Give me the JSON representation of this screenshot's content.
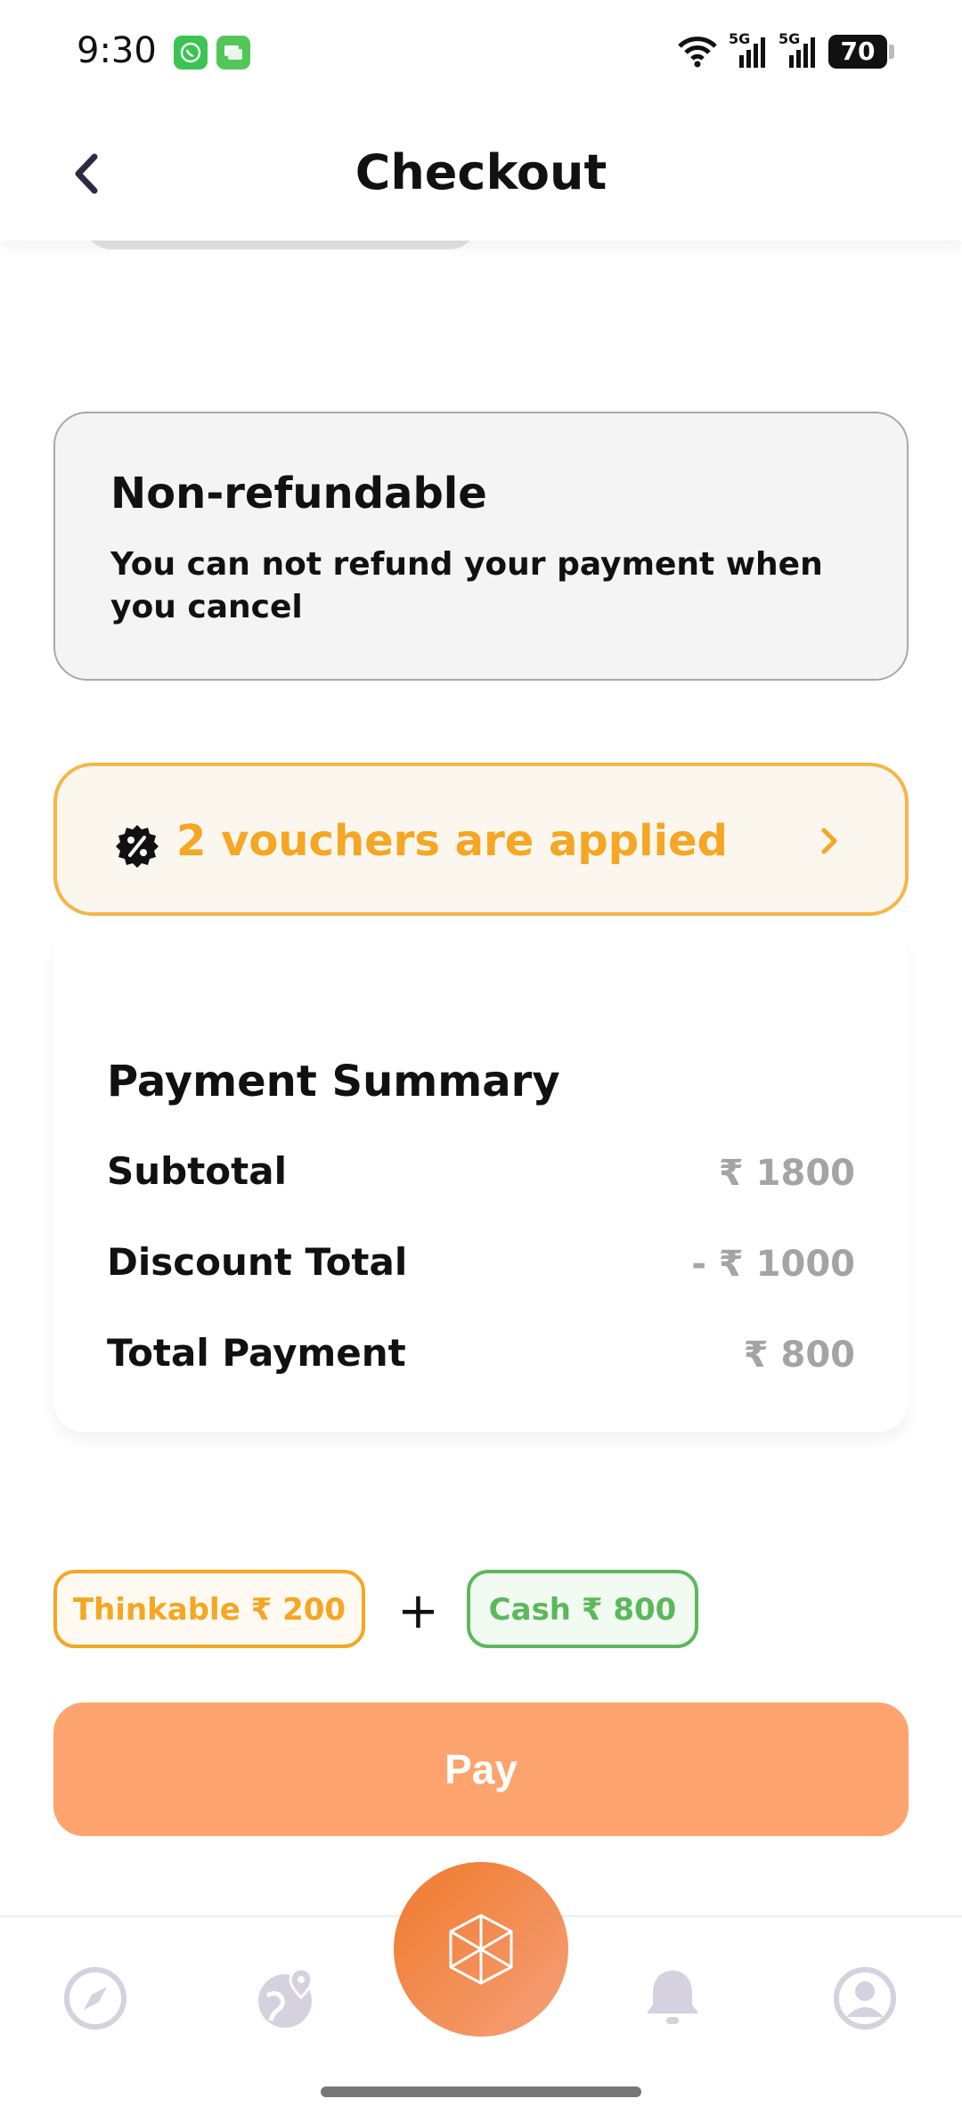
{
  "status_bar": {
    "time": "9:30",
    "battery": "70",
    "network_label": "5G"
  },
  "header": {
    "title": "Checkout"
  },
  "policy": {
    "title": "Non-refundable",
    "description": "You can not refund your payment when you cancel"
  },
  "vouchers": {
    "label": "2 vouchers are applied"
  },
  "summary": {
    "title": "Payment Summary",
    "rows": [
      {
        "label": "Subtotal",
        "value": "₹ 1800"
      },
      {
        "label": "Discount Total",
        "value": "- ₹ 1000"
      },
      {
        "label": "Total Payment",
        "value": "₹ 800"
      }
    ]
  },
  "split": {
    "thinkable": "Thinkable ₹ 200",
    "plus": "+",
    "cash": "Cash ₹ 800"
  },
  "pay_button": {
    "label": "Pay"
  },
  "colors": {
    "accent_orange": "#f5a623",
    "pay_button": "#fda46e",
    "cash_green": "#5cb85c",
    "nav_inactive": "#d6d1df"
  },
  "icons": {
    "back": "chevron-left-icon",
    "voucher": "discount-badge-icon",
    "voucher_arrow": "chevron-right-icon",
    "nav": [
      "compass-icon",
      "globe-pin-icon",
      "cube-icon",
      "bell-icon",
      "profile-icon"
    ]
  }
}
